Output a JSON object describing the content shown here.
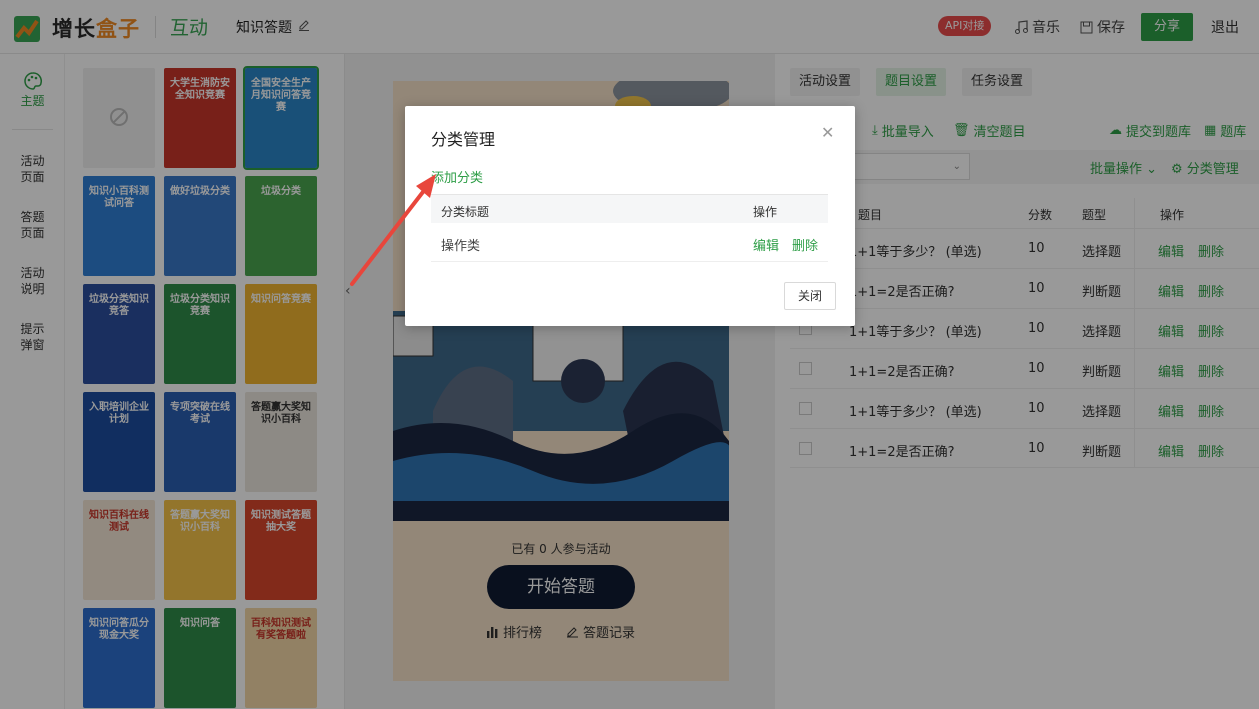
{
  "header": {
    "brand_prefix": "增长",
    "brand_accent": "盒子",
    "module": "互动",
    "activity_name": "知识答题",
    "api_badge": "API对接",
    "music": "音乐",
    "save": "保存",
    "share": "分享",
    "logout": "退出"
  },
  "leftnav": {
    "items": [
      {
        "label": "主题",
        "icon": "palette-icon",
        "active": true
      },
      {
        "label": "活动\n页面"
      },
      {
        "label": "答题\n页面"
      },
      {
        "label": "活动\n说明"
      },
      {
        "label": "提示\n弹窗"
      }
    ]
  },
  "gallery": {
    "templates": [
      {
        "label": ""
      },
      {
        "label": "大学生消防安全知识竞赛",
        "color": "#c9362b"
      },
      {
        "label": "全国安全生产月知识问答竞赛",
        "color": "#2a86c9"
      },
      {
        "label": "知识小百科测试问答",
        "color": "#2f7fd6"
      },
      {
        "label": "做好垃圾分类",
        "color": "#3a78c9"
      },
      {
        "label": "垃圾分类",
        "color": "#4aa54f"
      },
      {
        "label": "垃圾分类知识竞答",
        "color": "#2c4f9e"
      },
      {
        "label": "垃圾分类知识竞赛",
        "color": "#2f8d4a"
      },
      {
        "label": "知识问答竞赛",
        "color": "#f0b531"
      },
      {
        "label": "入职培训企业计划",
        "color": "#1d4ea0"
      },
      {
        "label": "专项突破在线考试",
        "color": "#2b5fb3"
      },
      {
        "label": "答题赢大奖知识小百科",
        "color": "#ece7de"
      },
      {
        "label": "知识百科在线测试",
        "color": "#f4e7d6"
      },
      {
        "label": "答题赢大奖知识小百科",
        "color": "#f5c34a"
      },
      {
        "label": "知识测试答题抽大奖",
        "color": "#d9462c"
      },
      {
        "label": "知识问答瓜分现金大奖",
        "color": "#2d6fcf"
      },
      {
        "label": "知识问答",
        "color": "#2f8d4a"
      },
      {
        "label": "百科知识测试有奖答题啦",
        "color": "#f3d7a7"
      }
    ]
  },
  "preview": {
    "participants": "已有 0 人参与活动",
    "start_button": "开始答题",
    "leaderboard": "排行榜",
    "records": "答题记录"
  },
  "settings": {
    "tabs": [
      {
        "label": "活动设置"
      },
      {
        "label": "题目设置",
        "active": true
      },
      {
        "label": "任务设置"
      }
    ],
    "toolbar": {
      "batch_import": "批量导入",
      "clear_questions": "清空题目",
      "submit_to_bank": "提交到题库",
      "question_bank": "题库"
    },
    "bulk_ops": "批量操作",
    "category_mgmt": "分类管理",
    "table": {
      "headers": [
        "题目",
        "分数",
        "题型",
        "操作"
      ],
      "rows": [
        {
          "q": "1+1等于多少？ (单选)",
          "score": "10",
          "type": "选择题"
        },
        {
          "q": "1+1=2是否正确?",
          "score": "10",
          "type": "判断题"
        },
        {
          "q": "1+1等于多少？ (单选)",
          "score": "10",
          "type": "选择题"
        },
        {
          "q": "1+1=2是否正确?",
          "score": "10",
          "type": "判断题"
        },
        {
          "q": "1+1等于多少？ (单选)",
          "score": "10",
          "type": "选择题"
        },
        {
          "q": "1+1=2是否正确?",
          "score": "10",
          "type": "判断题"
        }
      ],
      "edit": "编辑",
      "delete": "删除"
    }
  },
  "modal": {
    "title": "分类管理",
    "add_category": "添加分类",
    "headers": [
      "分类标题",
      "操作"
    ],
    "rows": [
      {
        "title": "操作类",
        "edit": "编辑",
        "delete": "删除"
      }
    ],
    "close_button": "关闭"
  },
  "colors": {
    "brand_green": "#2e9e47",
    "brand_orange": "#f08a24",
    "api_red": "#e94b4b",
    "annotation_red": "#e8463c"
  }
}
